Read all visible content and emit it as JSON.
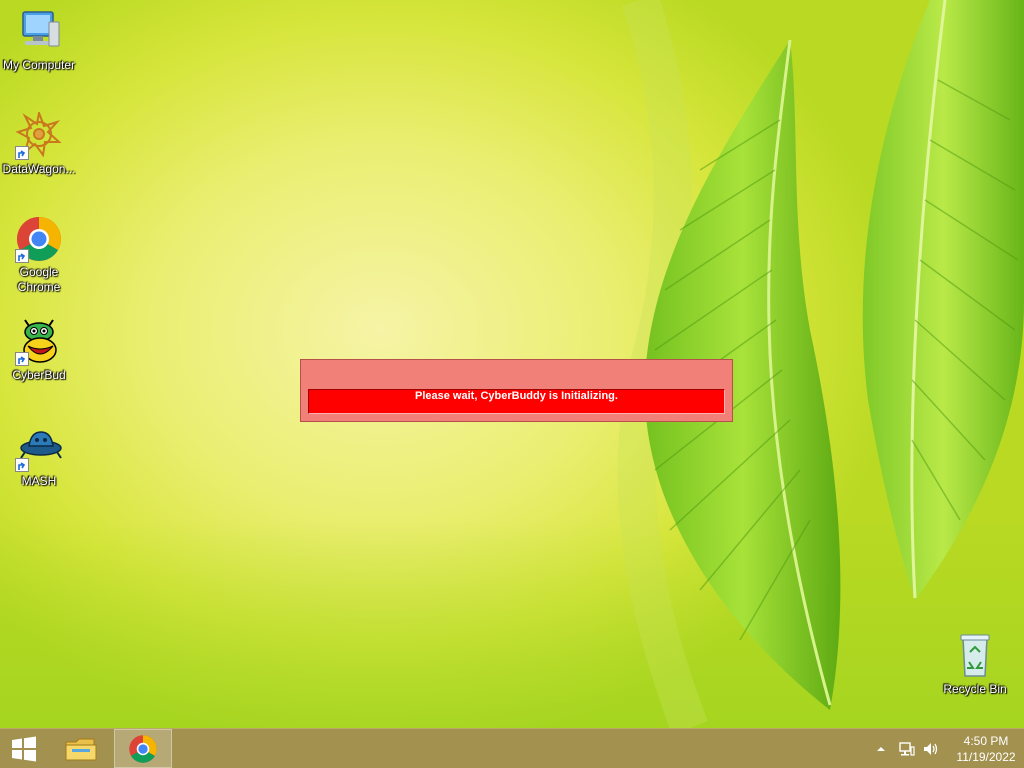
{
  "desktop": {
    "icons": [
      {
        "label": "My Computer",
        "icon": "computer-icon"
      },
      {
        "label": "DataWagon...",
        "icon": "datawagon-icon"
      },
      {
        "label": "Google Chrome",
        "icon": "chrome-icon"
      },
      {
        "label": "CyberBud",
        "icon": "cyberbud-icon"
      },
      {
        "label": "MASH",
        "icon": "mash-icon"
      },
      {
        "label": "Recycle Bin",
        "icon": "recycle-bin-icon"
      }
    ]
  },
  "dialog": {
    "message": "Please wait, CyberBuddy is Initializing.",
    "colors": {
      "frame": "#f08078",
      "bar": "#ff0000"
    }
  },
  "taskbar": {
    "color": "#a3914f",
    "buttons": [
      {
        "name": "start",
        "icon": "windows-logo-icon"
      },
      {
        "name": "file-explorer",
        "icon": "folder-icon"
      },
      {
        "name": "google-chrome",
        "icon": "chrome-icon"
      }
    ],
    "tray": {
      "overflow_icon": "chevron-up-icon",
      "network_icon": "network-icon",
      "volume_icon": "speaker-icon"
    },
    "clock": {
      "time": "4:50 PM",
      "date": "11/19/2022"
    }
  }
}
